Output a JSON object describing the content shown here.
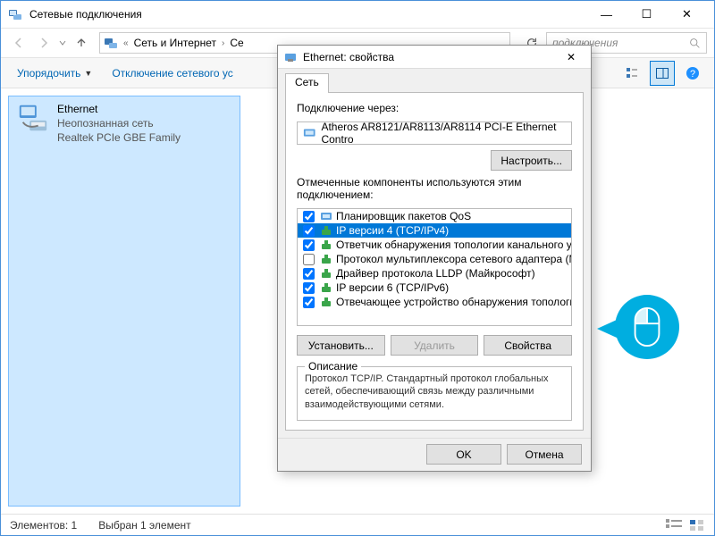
{
  "mainWindow": {
    "title": "Сетевые подключения",
    "breadcrumb": {
      "sep": "«",
      "part1": "Сеть и Интернет",
      "part2": "Се"
    },
    "searchPlaceholder": "подключения",
    "commands": {
      "organize": "Упорядочить",
      "disable": "Отключение сетевого ус"
    },
    "adapter": {
      "name": "Ethernet",
      "status": "Неопознанная сеть",
      "device": "Realtek PCIe GBE Family"
    },
    "status": {
      "count": "Элементов: 1",
      "selected": "Выбран 1 элемент"
    }
  },
  "dialog": {
    "title": "Ethernet: свойства",
    "tab": "Сеть",
    "connectUsing": "Подключение через:",
    "adapterName": "Atheros AR8121/AR8113/AR8114 PCI-E Ethernet Contro",
    "configure": "Настроить...",
    "componentsLabel": "Отмеченные компоненты используются этим подключением:",
    "components": [
      {
        "checked": true,
        "label": "Планировщик пакетов QoS",
        "selected": false
      },
      {
        "checked": true,
        "label": "IP версии 4 (TCP/IPv4)",
        "selected": true
      },
      {
        "checked": true,
        "label": "Ответчик обнаружения топологии канального уров",
        "selected": false
      },
      {
        "checked": false,
        "label": "Протокол мультиплексора сетевого адаптера (Ма",
        "selected": false
      },
      {
        "checked": true,
        "label": "Драйвер протокола LLDP (Майкрософт)",
        "selected": false
      },
      {
        "checked": true,
        "label": "IP версии 6 (TCP/IPv6)",
        "selected": false
      },
      {
        "checked": true,
        "label": "Отвечающее устройство обнаружения топологии к",
        "selected": false
      }
    ],
    "install": "Установить...",
    "uninstall": "Удалить",
    "properties": "Свойства",
    "descLegend": "Описание",
    "descText": "Протокол TCP/IP. Стандартный протокол глобальных сетей, обеспечивающий связь между различными взаимодействующими сетями.",
    "ok": "OK",
    "cancel": "Отмена"
  }
}
